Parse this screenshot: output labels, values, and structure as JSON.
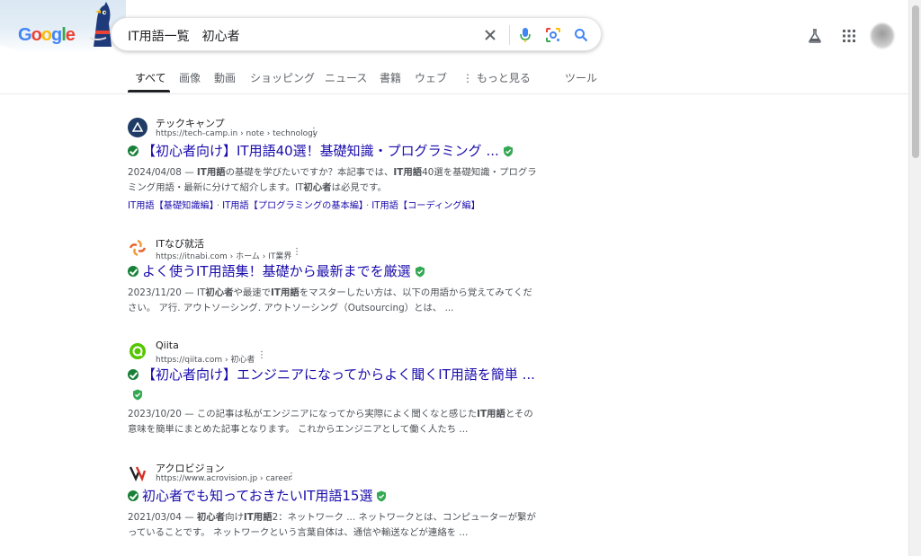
{
  "header": {
    "logo_text": "Google",
    "search_query": "IT用語一覧　初心者",
    "icons": [
      "close-icon",
      "mic-icon",
      "lens-icon",
      "search-icon",
      "labs-icon",
      "apps-icon",
      "avatar"
    ]
  },
  "tabs": {
    "items": [
      "すべて",
      "画像",
      "動画",
      "ショッピング",
      "ニュース",
      "書籍",
      "ウェブ",
      "もっと見る",
      "ツール"
    ],
    "active": "すべて"
  },
  "results": [
    {
      "site_name": "テックキャンプ",
      "url": "https://tech-camp.in › note › technology",
      "title": "【初心者向け】IT用語40選！基礎知識・プログラミング ...",
      "date": "2024/04/08",
      "snippet_line1_pre": " — ",
      "snippet_b1": "IT用語",
      "snippet_t1": "の基礎を学びたいですか？本記事では、",
      "snippet_b2": "IT用語",
      "snippet_t2": "40選を基礎知識・プログラ",
      "snippet_line2_t1": "ミング用語・最新に分けて紹介します。IT",
      "snippet_line2_b1": "初心者",
      "snippet_line2_t2": "は必見です。",
      "sitelinks": [
        "IT用語【基礎知識編】",
        "IT用語【プログラミングの基本編】",
        "IT用語【コーディング編】"
      ],
      "sitelink_sep": "·"
    },
    {
      "site_name": "ITなび就活",
      "url": "https://itnabi.com › ホーム › IT業界",
      "title": "よく使うIT用語集！基礎から最新までを厳選",
      "date": "2023/11/20",
      "snippet_line1_pre": " — IT",
      "snippet_b1": "初心者",
      "snippet_t1": "や最速で",
      "snippet_b2": "IT用語",
      "snippet_t2": "をマスターしたい方は、以下の用語から覚えてみてくだ",
      "snippet_line2": "さい。 ア行. アウトソーシング. アウトソーシング（Outsourcing）とは、 ..."
    },
    {
      "site_name": "Qiita",
      "url": "https://qiita.com › 初心者",
      "title": "【初心者向け】エンジニアになってからよく聞くIT用語を簡単 ...",
      "date": "2023/10/20",
      "snippet_line1_pre": " — この記事は私がエンジニアになってから実際によく聞くなと感じた",
      "snippet_b1": "IT用語",
      "snippet_t1": "とその",
      "snippet_line2": "意味を簡単にまとめた記事となります。 これからエンジニアとして働く人たち ..."
    },
    {
      "site_name": "アクロビジョン",
      "url": "https://www.acrovision.jp › career",
      "title": "初心者でも知っておきたいIT用語15選",
      "date": "2021/03/04",
      "snippet_line1_pre": " — ",
      "snippet_b1": "初心者",
      "snippet_t1": "向け",
      "snippet_b2": "IT用語",
      "snippet_t2": "2：ネットワーク ... ネットワークとは、コンピューターが繋が",
      "snippet_line2": "っていることです。 ネットワークという言葉自体は、通信や輸送などが連絡を ..."
    }
  ],
  "colors": {
    "link": "#1a0dab",
    "verified_green": "#188038",
    "shield_green": "#34a853",
    "snippet_gray": "#4d5156"
  }
}
